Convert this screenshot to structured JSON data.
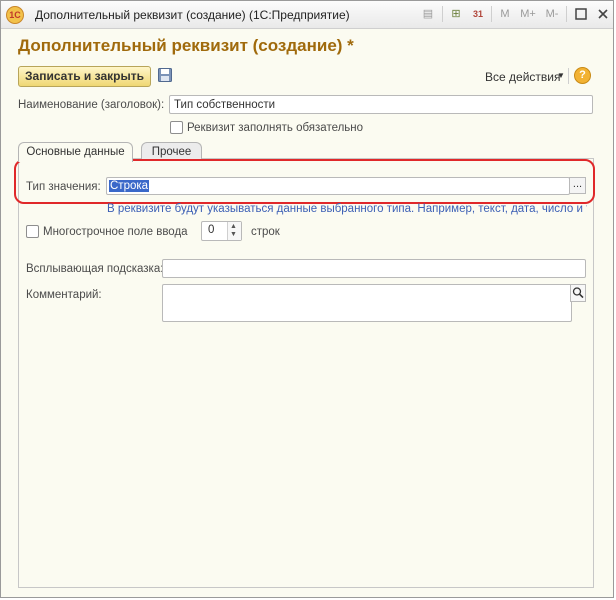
{
  "window": {
    "title": "Дополнительный реквизит (создание)  (1С:Предприятие)",
    "app_icon": "1c-logo-icon",
    "toolbar_icons": {
      "calc": "⊞",
      "calendar": "31",
      "m": "M",
      "m_plus": "M+",
      "m_minus": "M-"
    }
  },
  "form": {
    "title": "Дополнительный реквизит (создание) *",
    "save_close_label": "Записать и закрыть",
    "all_actions_label": "Все действия",
    "help_label": "?"
  },
  "fields": {
    "name_label": "Наименование (заголовок):",
    "name_value": "Тип собственности",
    "required_label": "Реквизит заполнять обязательно",
    "required_checked": false
  },
  "tabs": [
    {
      "label": "Основные данные",
      "active": true
    },
    {
      "label": "Прочее",
      "active": false
    }
  ],
  "main": {
    "value_type_label": "Тип значения:",
    "value_type_value": "Строка",
    "choose_label": "...",
    "hint": "В реквизите будут указываться данные выбранного типа. Например, текст, дата, число и т.п.",
    "multiline_label": "Многострочное поле ввода",
    "multiline_checked": false,
    "lines_value": "0",
    "lines_unit": "строк",
    "tooltip_label": "Всплывающая подсказка:",
    "tooltip_value": "",
    "comment_label": "Комментарий:",
    "comment_value": ""
  },
  "colors": {
    "title": "#a06a0c",
    "hint": "#3c5fb5",
    "highlight": "#e0282a",
    "selection": "#3a68c9"
  }
}
